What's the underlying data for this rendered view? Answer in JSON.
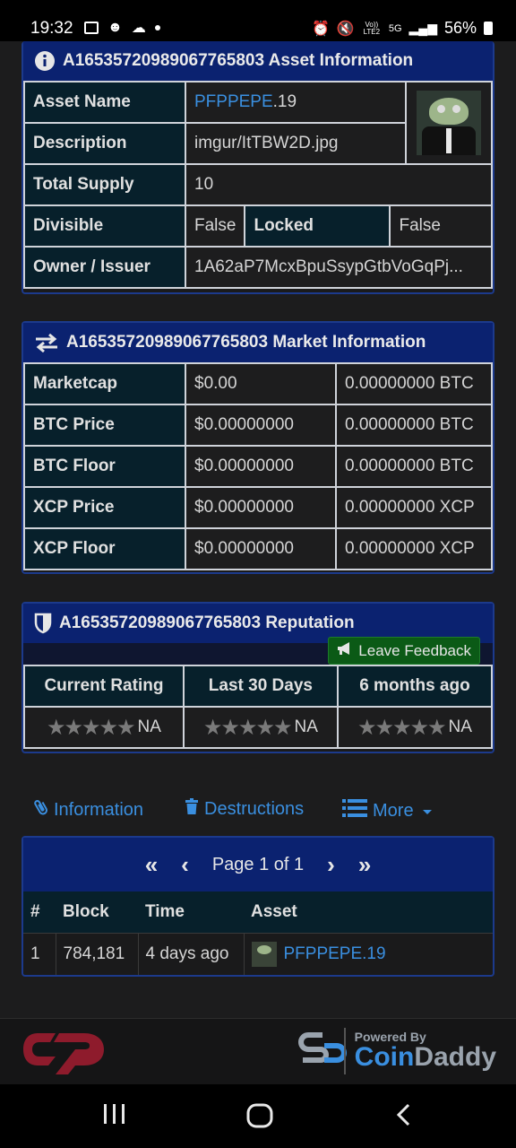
{
  "status_bar": {
    "time": "19:32",
    "volte_label": "Vo)) LTE2",
    "network": "5G",
    "battery": "56%"
  },
  "asset_info": {
    "title": "A16535720989067765803 Asset Information",
    "rows": {
      "asset_name_label": "Asset Name",
      "asset_name_value_link": "PFPPEPE",
      "asset_name_value_suffix": ".19",
      "description_label": "Description",
      "description_value": "imgur/ItTBW2D.jpg",
      "total_supply_label": "Total Supply",
      "total_supply_value": "10",
      "divisible_label": "Divisible",
      "divisible_value": "False",
      "locked_label": "Locked",
      "locked_value": "False",
      "owner_label": "Owner / Issuer",
      "owner_value": "1A62aP7McxBpuSsypGtbVoGqPj..."
    }
  },
  "market_info": {
    "title": "A16535720989067765803 Market Information",
    "rows": [
      {
        "label": "Marketcap",
        "usd": "$0.00",
        "native": "0.00000000 BTC"
      },
      {
        "label": "BTC Price",
        "usd": "$0.00000000",
        "native": "0.00000000 BTC"
      },
      {
        "label": "BTC Floor",
        "usd": "$0.00000000",
        "native": "0.00000000 BTC"
      },
      {
        "label": "XCP Price",
        "usd": "$0.00000000",
        "native": "0.00000000 XCP"
      },
      {
        "label": "XCP Floor",
        "usd": "$0.00000000",
        "native": "0.00000000 XCP"
      }
    ]
  },
  "reputation": {
    "title": "A16535720989067765803 Reputation",
    "feedback_button": "Leave Feedback",
    "columns": [
      "Current Rating",
      "Last 30 Days",
      "6 months ago"
    ],
    "values": [
      "NA",
      "NA",
      "NA"
    ]
  },
  "tabs": {
    "information": "Information",
    "destructions": "Destructions",
    "more": "More"
  },
  "pager": {
    "label": "Page 1 of 1"
  },
  "history": {
    "headers": [
      "#",
      "Block",
      "Time",
      "Asset"
    ],
    "rows": [
      {
        "num": "1",
        "block": "784,181",
        "time": "4 days ago",
        "asset": "PFPPEPE.19"
      }
    ]
  },
  "footer": {
    "powered_by": "Powered By",
    "brand_coin": "Coin",
    "brand_daddy": "Daddy"
  }
}
